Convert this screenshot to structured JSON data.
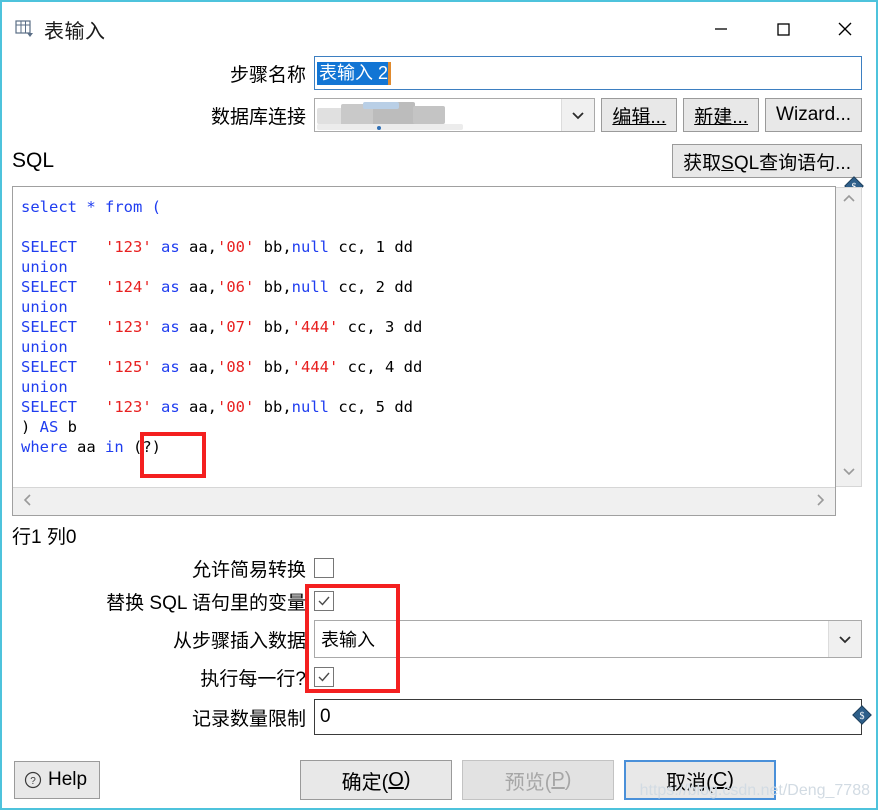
{
  "window": {
    "title": "表输入",
    "icon": "table-input-icon",
    "border_color": "#4EC3DC",
    "controls": {
      "minimize": "minimize-icon",
      "maximize": "maximize-icon",
      "close": "close-icon"
    }
  },
  "form": {
    "step_name_label": "步骤名称",
    "step_name_value": "表输入 2",
    "step_name_selected": true,
    "connection_label": "数据库连接",
    "connection_value": "",
    "connection_redacted": true,
    "edit_button": "编辑...",
    "new_button": "新建...",
    "wizard_button": "Wizard..."
  },
  "sql": {
    "section_title": "SQL",
    "get_query_button": "获取SQL查询语句...",
    "get_query_button_mnemonic": "S",
    "caret_status": "行1 列0",
    "variable_badge": "variable-dollar-icon",
    "lines": [
      [
        {
          "t": "select * from (",
          "c": "kw"
        }
      ],
      [],
      [
        {
          "t": "SELECT",
          "c": "kw"
        },
        {
          "t": "   ",
          "c": "pln"
        },
        {
          "t": "'123'",
          "c": "str"
        },
        {
          "t": " ",
          "c": "pln"
        },
        {
          "t": "as",
          "c": "kw"
        },
        {
          "t": " aa,",
          "c": "pln"
        },
        {
          "t": "'00'",
          "c": "str"
        },
        {
          "t": " bb,",
          "c": "pln"
        },
        {
          "t": "null",
          "c": "kw"
        },
        {
          "t": " cc, 1 dd",
          "c": "pln"
        }
      ],
      [
        {
          "t": "union",
          "c": "kw"
        }
      ],
      [
        {
          "t": "SELECT",
          "c": "kw"
        },
        {
          "t": "   ",
          "c": "pln"
        },
        {
          "t": "'124'",
          "c": "str"
        },
        {
          "t": " ",
          "c": "pln"
        },
        {
          "t": "as",
          "c": "kw"
        },
        {
          "t": " aa,",
          "c": "pln"
        },
        {
          "t": "'06'",
          "c": "str"
        },
        {
          "t": " bb,",
          "c": "pln"
        },
        {
          "t": "null",
          "c": "kw"
        },
        {
          "t": " cc, 2 dd",
          "c": "pln"
        }
      ],
      [
        {
          "t": "union",
          "c": "kw"
        }
      ],
      [
        {
          "t": "SELECT",
          "c": "kw"
        },
        {
          "t": "   ",
          "c": "pln"
        },
        {
          "t": "'123'",
          "c": "str"
        },
        {
          "t": " ",
          "c": "pln"
        },
        {
          "t": "as",
          "c": "kw"
        },
        {
          "t": " aa,",
          "c": "pln"
        },
        {
          "t": "'07'",
          "c": "str"
        },
        {
          "t": " bb,",
          "c": "pln"
        },
        {
          "t": "'444'",
          "c": "str"
        },
        {
          "t": " cc, 3 dd",
          "c": "pln"
        }
      ],
      [
        {
          "t": "union",
          "c": "kw"
        }
      ],
      [
        {
          "t": "SELECT",
          "c": "kw"
        },
        {
          "t": "   ",
          "c": "pln"
        },
        {
          "t": "'125'",
          "c": "str"
        },
        {
          "t": " ",
          "c": "pln"
        },
        {
          "t": "as",
          "c": "kw"
        },
        {
          "t": " aa,",
          "c": "pln"
        },
        {
          "t": "'08'",
          "c": "str"
        },
        {
          "t": " bb,",
          "c": "pln"
        },
        {
          "t": "'444'",
          "c": "str"
        },
        {
          "t": " cc, 4 dd",
          "c": "pln"
        }
      ],
      [
        {
          "t": "union",
          "c": "kw"
        }
      ],
      [
        {
          "t": "SELECT",
          "c": "kw"
        },
        {
          "t": "   ",
          "c": "pln"
        },
        {
          "t": "'123'",
          "c": "str"
        },
        {
          "t": " ",
          "c": "pln"
        },
        {
          "t": "as",
          "c": "kw"
        },
        {
          "t": " aa,",
          "c": "pln"
        },
        {
          "t": "'00'",
          "c": "str"
        },
        {
          "t": " bb,",
          "c": "pln"
        },
        {
          "t": "null",
          "c": "kw"
        },
        {
          "t": " cc, 5 dd",
          "c": "pln"
        }
      ],
      [
        {
          "t": ") ",
          "c": "pln"
        },
        {
          "t": "AS",
          "c": "kw"
        },
        {
          "t": " b",
          "c": "pln"
        }
      ],
      [
        {
          "t": "where",
          "c": "kw"
        },
        {
          "t": " aa ",
          "c": "pln"
        },
        {
          "t": "in",
          "c": "kw"
        },
        {
          "t": " (?)",
          "c": "pln"
        }
      ]
    ]
  },
  "options": {
    "allow_lazy_label": "允许简易转换",
    "allow_lazy_checked": false,
    "replace_vars_label": "替换 SQL 语句里的变量",
    "replace_vars_checked": true,
    "insert_from_step_label": "从步骤插入数据",
    "insert_from_step_value": "表输入",
    "execute_each_row_label": "执行每一行?",
    "execute_each_row_checked": true,
    "limit_label": "记录数量限制",
    "limit_value": "0",
    "limit_variable_badge": "variable-dollar-icon"
  },
  "annotations": {
    "color": "#f42020",
    "boxes": [
      "sql-placeholder-highlight",
      "options-highlight"
    ]
  },
  "footer": {
    "help_label": "Help",
    "ok_label": "确定(O)",
    "preview_label": "预览(P)",
    "preview_disabled": true,
    "cancel_label": "取消(C)",
    "cancel_focused": true,
    "watermark": "https://blog.csdn.net/Deng_7788"
  }
}
